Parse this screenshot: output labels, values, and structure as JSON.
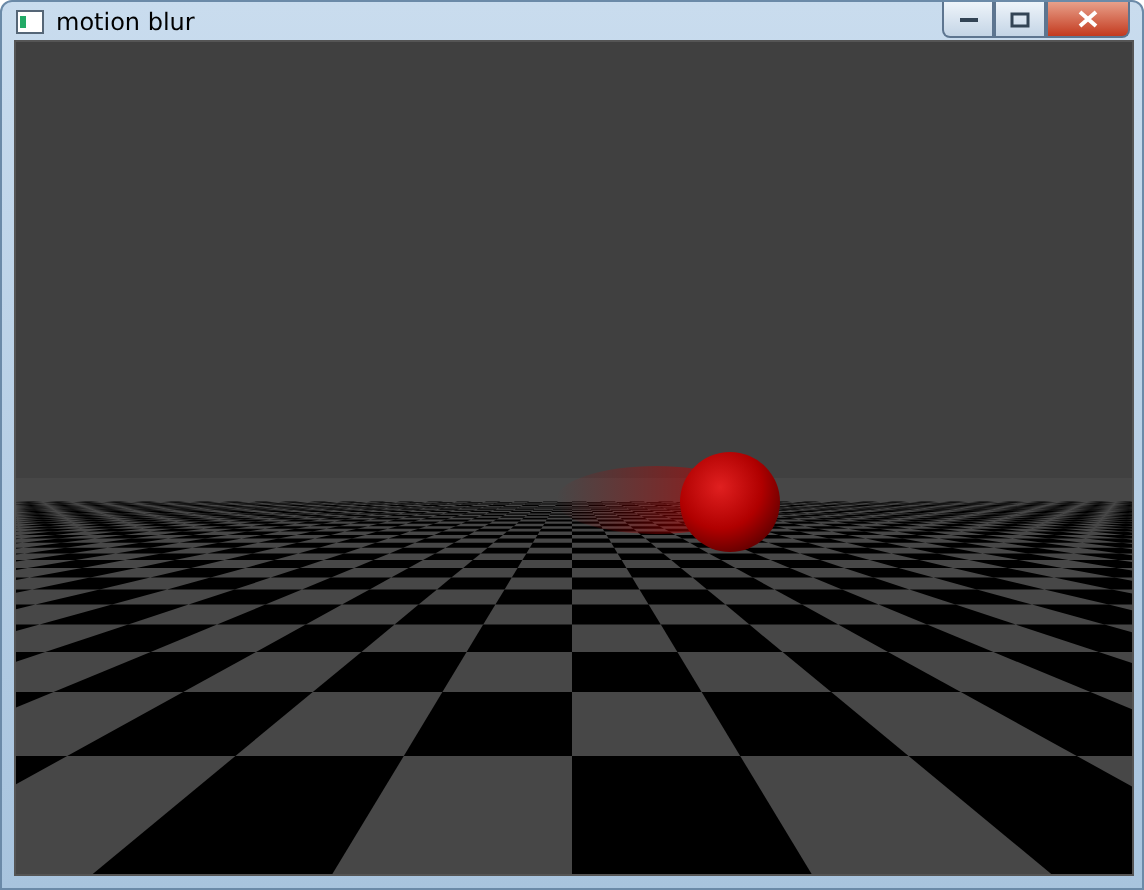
{
  "window": {
    "title": "motion blur"
  }
}
